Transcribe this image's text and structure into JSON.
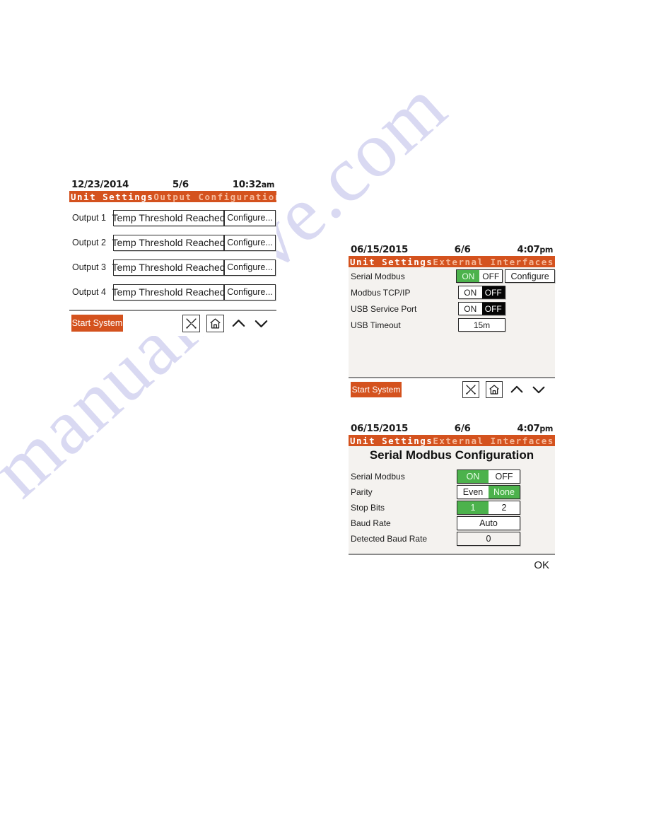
{
  "watermark": {
    "text": "manualshive.com"
  },
  "panels": [
    {
      "id": "output-config",
      "status": {
        "date": "12/23/2014",
        "page": "5/6",
        "time": "10:32",
        "ampm": "am"
      },
      "title": {
        "left": "Unit Settings",
        "right": "Output Configuration"
      },
      "rows": [
        {
          "label": "Output 1",
          "value": "Temp Threshold Reached",
          "action": "Configure..."
        },
        {
          "label": "Output 2",
          "value": "Temp Threshold Reached",
          "action": "Configure..."
        },
        {
          "label": "Output 3",
          "value": "Temp Threshold Reached",
          "action": "Configure..."
        },
        {
          "label": "Output 4",
          "value": "Temp Threshold Reached",
          "action": "Configure..."
        }
      ],
      "footer": {
        "start_button": "Start System"
      },
      "icons": [
        "tools-icon",
        "home-icon",
        "chevron-up-icon",
        "chevron-down-icon"
      ]
    },
    {
      "id": "ext-interfaces",
      "status": {
        "date": "06/15/2015",
        "page": "6/6",
        "time": "4:07",
        "ampm": "pm"
      },
      "title": {
        "left": "Unit Settings",
        "right": "External Interfaces"
      },
      "rows": [
        {
          "label": "Serial Modbus",
          "type": "toggle",
          "options": [
            "ON",
            "OFF"
          ],
          "selected": "ON",
          "selected_style": "green",
          "action": "Configure"
        },
        {
          "label": "Modbus TCP/IP",
          "type": "toggle",
          "options": [
            "ON",
            "OFF"
          ],
          "selected": "OFF",
          "selected_style": "black"
        },
        {
          "label": "USB Service Port",
          "type": "toggle",
          "options": [
            "ON",
            "OFF"
          ],
          "selected": "OFF",
          "selected_style": "black"
        },
        {
          "label": "USB Timeout",
          "type": "value",
          "value": "15m"
        }
      ],
      "footer": {
        "start_button": "Start System"
      },
      "icons": [
        "tools-icon",
        "home-icon",
        "chevron-up-icon",
        "chevron-down-icon"
      ]
    },
    {
      "id": "serial-config",
      "status": {
        "date": "06/15/2015",
        "page": "6/6",
        "time": "4:07",
        "ampm": "pm"
      },
      "title": {
        "left": "Unit Settings",
        "right": "External Interfaces"
      },
      "page_title": "Serial Modbus Configuration",
      "rows": [
        {
          "label": "Serial Modbus",
          "type": "toggle",
          "options": [
            "ON",
            "OFF"
          ],
          "selected": "ON",
          "selected_style": "green"
        },
        {
          "label": "Parity",
          "type": "toggle",
          "options": [
            "Even",
            "None"
          ],
          "selected": "None",
          "selected_style": "green"
        },
        {
          "label": "Stop Bits",
          "type": "toggle",
          "options": [
            "1",
            "2"
          ],
          "selected": "1",
          "selected_style": "green"
        },
        {
          "label": "Baud Rate",
          "type": "value",
          "value": "Auto"
        },
        {
          "label": "Detected Baud Rate",
          "type": "value",
          "value": "0",
          "readonly": true
        }
      ],
      "ok_label": "OK"
    }
  ],
  "colors": {
    "accent_orange": "#d4521e",
    "toggle_green": "#4cb24c",
    "toggle_black": "#050505",
    "title_right_text": "#f5b99a",
    "screen_bg": "#f4f2ef",
    "watermark": "#d9d9f2"
  }
}
